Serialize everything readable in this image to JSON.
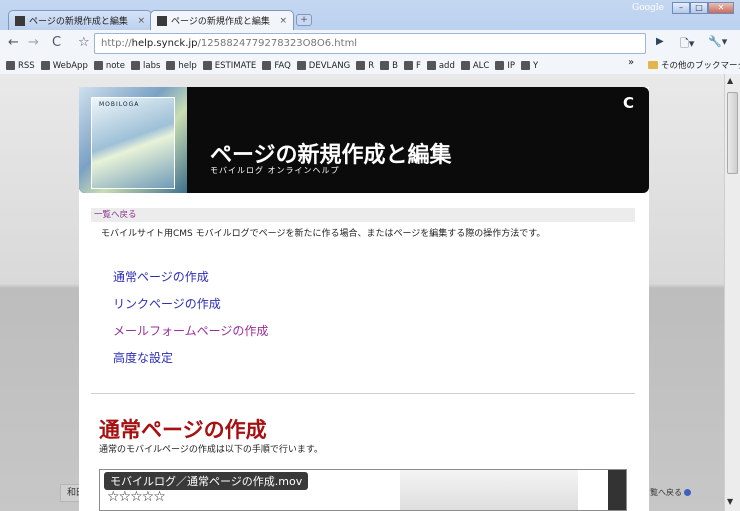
{
  "browser": {
    "tabs": [
      {
        "label": "ページの新規作成と編集",
        "close": "×"
      },
      {
        "label": "ページの新規作成と編集",
        "close": "×"
      }
    ],
    "new_tab": "+",
    "google_label": "Google",
    "window_buttons": {
      "minimize": "–",
      "maximize": "□",
      "close": "✕"
    },
    "nav": {
      "back": "←",
      "forward": "→",
      "reload": "C",
      "star": "☆",
      "go": "▶",
      "page_menu": "🗋▾",
      "wrench": "🔧▾"
    },
    "url": {
      "scheme": "http://",
      "host": "help.synck.jp",
      "path": "/1258824779278323O8O6.html"
    },
    "bookmarks": [
      "RSS",
      "WebApp",
      "note",
      "labs",
      "help",
      "ESTIMATE",
      "FAQ",
      "DEVLANG",
      "R",
      "B",
      "F",
      "add",
      "ALC",
      "IP",
      "Y"
    ],
    "bookmarks_more": "»",
    "bookmarks_other": "その他のブックマーク"
  },
  "header": {
    "logo": "MOBILOGA",
    "title": "ページの新規作成と編集",
    "subtitle": "モバイルログ オンラインヘルプ",
    "reload": "C"
  },
  "breadcrumb": "一覧へ戻る",
  "intro": "モバイルサイト用CMS モバイルログでページを新たに作る場合、またはページを編集する際の操作方法です。",
  "toc": [
    "通常ページの作成",
    "リンクページの作成",
    "メールフォームページの作成",
    "高度な設定"
  ],
  "section": {
    "title": "通常ページの作成",
    "description": "通常のモバイルページの作成は以下の手順で行います。"
  },
  "video": {
    "caption": "モバイルログ／通常ページの作成.mov",
    "stars": "☆☆☆☆☆"
  },
  "footer": {
    "left": "和田",
    "right": "覧へ戻る"
  }
}
